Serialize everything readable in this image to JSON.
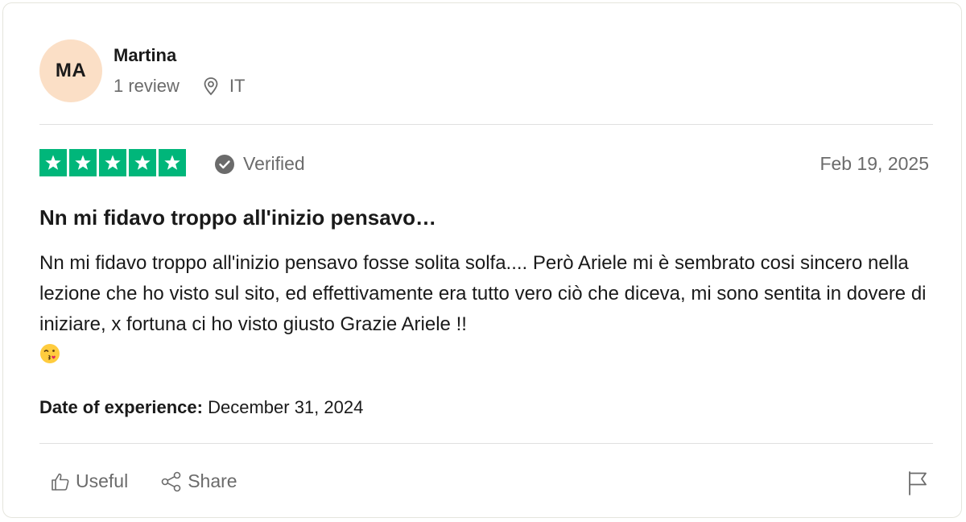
{
  "reviewer": {
    "initials": "MA",
    "name": "Martina",
    "review_count": "1 review",
    "country": "IT",
    "avatar_color": "#fbdfc6"
  },
  "review": {
    "rating": 5,
    "max_rating": 5,
    "star_color": "#00b67a",
    "verified_label": "Verified",
    "date": "Feb 19, 2025",
    "title": "Nn mi fidavo troppo all'inizio pensavo…",
    "body": "Nn mi fidavo troppo all'inizio pensavo fosse solita solfa.... Però Ariele mi è sembrato cosi sincero nella lezione che ho visto sul sito, ed effettivamente era tutto vero ciò che diceva, mi sono sentita in dovere di iniziare, x fortuna ci ho visto giusto Grazie Ariele !!",
    "emoji": "face-blowing-kiss",
    "experience_label": "Date of experience:",
    "experience_date": "December 31, 2024"
  },
  "actions": {
    "useful_label": "Useful",
    "share_label": "Share",
    "icons": [
      "thumbs-up-icon",
      "share-icon",
      "flag-icon"
    ]
  }
}
